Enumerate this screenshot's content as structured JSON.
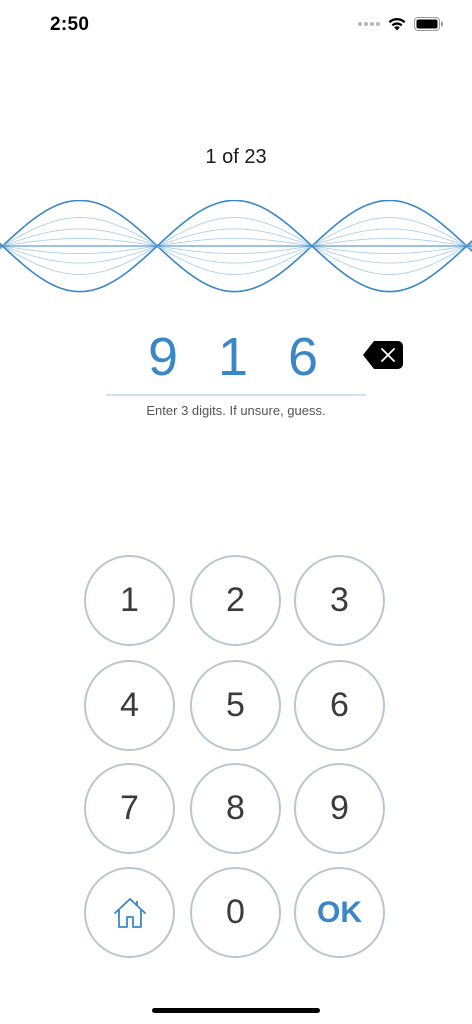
{
  "status_bar": {
    "time": "2:50"
  },
  "progress": {
    "label": "1 of 23",
    "current": 1,
    "total": 23
  },
  "entry": {
    "digits": [
      "9",
      "1",
      "6"
    ],
    "hint": "Enter 3 digits. If unsure, guess."
  },
  "keypad": {
    "keys": [
      "1",
      "2",
      "3",
      "4",
      "5",
      "6",
      "7",
      "8",
      "9"
    ],
    "zero": "0",
    "ok": "OK"
  },
  "colors": {
    "accent": "#3a87c8",
    "key_border": "#b9c6d0",
    "entry_line": "#cfe3ef"
  },
  "icons": {
    "backspace": "backspace-icon",
    "home": "home-icon",
    "wifi": "wifi-icon",
    "battery": "battery-icon",
    "signal": "signal-icon"
  }
}
